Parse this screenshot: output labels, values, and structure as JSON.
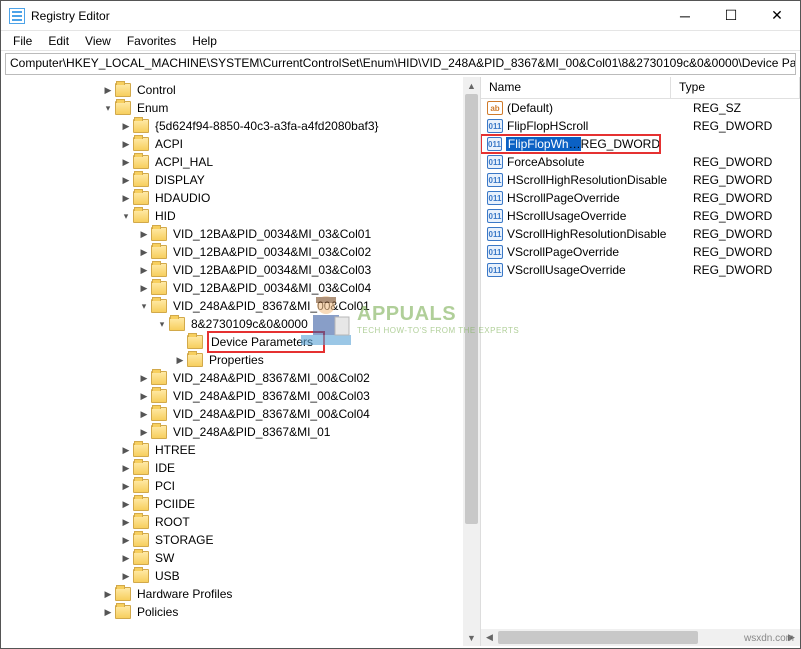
{
  "window": {
    "title": "Registry Editor"
  },
  "menu": {
    "file": "File",
    "edit": "Edit",
    "view": "View",
    "favorites": "Favorites",
    "help": "Help"
  },
  "address": "Computer\\HKEY_LOCAL_MACHINE\\SYSTEM\\CurrentControlSet\\Enum\\HID\\VID_248A&PID_8367&MI_00&Col01\\8&2730109c&0&0000\\Device Par",
  "tree": {
    "control": "Control",
    "enum": "Enum",
    "guid": "{5d624f94-8850-40c3-a3fa-a4fd2080baf3}",
    "acpi": "ACPI",
    "acpi_hal": "ACPI_HAL",
    "display": "DISPLAY",
    "hdaudio": "HDAUDIO",
    "hid": "HID",
    "vid12_1": "VID_12BA&PID_0034&MI_03&Col01",
    "vid12_2": "VID_12BA&PID_0034&MI_03&Col02",
    "vid12_3": "VID_12BA&PID_0034&MI_03&Col03",
    "vid12_4": "VID_12BA&PID_0034&MI_03&Col04",
    "vid248_1": "VID_248A&PID_8367&MI_00&Col01",
    "instance": "8&2730109c&0&0000",
    "device_params": "Device Parameters",
    "properties": "Properties",
    "vid248_2": "VID_248A&PID_8367&MI_00&Col02",
    "vid248_3": "VID_248A&PID_8367&MI_00&Col03",
    "vid248_4": "VID_248A&PID_8367&MI_00&Col04",
    "vid248_5": "VID_248A&PID_8367&MI_01",
    "htree": "HTREE",
    "ide": "IDE",
    "pci": "PCI",
    "pciide": "PCIIDE",
    "root": "ROOT",
    "storage": "STORAGE",
    "sw": "SW",
    "usb": "USB",
    "hwprofiles": "Hardware Profiles",
    "policies": "Policies"
  },
  "values": {
    "header_name": "Name",
    "header_type": "Type",
    "rows": [
      {
        "name": "(Default)",
        "type": "REG_SZ",
        "kind": "str",
        "selected": false,
        "hi": false
      },
      {
        "name": "FlipFlopHScroll",
        "type": "REG_DWORD",
        "kind": "dw",
        "selected": false,
        "hi": false
      },
      {
        "name": "FlipFlopWheel",
        "type": "REG_DWORD",
        "kind": "dw",
        "selected": true,
        "hi": true
      },
      {
        "name": "ForceAbsolute",
        "type": "REG_DWORD",
        "kind": "dw",
        "selected": false,
        "hi": false
      },
      {
        "name": "HScrollHighResolutionDisable",
        "type": "REG_DWORD",
        "kind": "dw",
        "selected": false,
        "hi": false
      },
      {
        "name": "HScrollPageOverride",
        "type": "REG_DWORD",
        "kind": "dw",
        "selected": false,
        "hi": false
      },
      {
        "name": "HScrollUsageOverride",
        "type": "REG_DWORD",
        "kind": "dw",
        "selected": false,
        "hi": false
      },
      {
        "name": "VScrollHighResolutionDisable",
        "type": "REG_DWORD",
        "kind": "dw",
        "selected": false,
        "hi": false
      },
      {
        "name": "VScrollPageOverride",
        "type": "REG_DWORD",
        "kind": "dw",
        "selected": false,
        "hi": false
      },
      {
        "name": "VScrollUsageOverride",
        "type": "REG_DWORD",
        "kind": "dw",
        "selected": false,
        "hi": false
      }
    ]
  },
  "watermark": {
    "brand": "APPUALS",
    "tag": "TECH HOW-TO'S FROM THE EXPERTS"
  },
  "attrib": "wsxdn.com"
}
